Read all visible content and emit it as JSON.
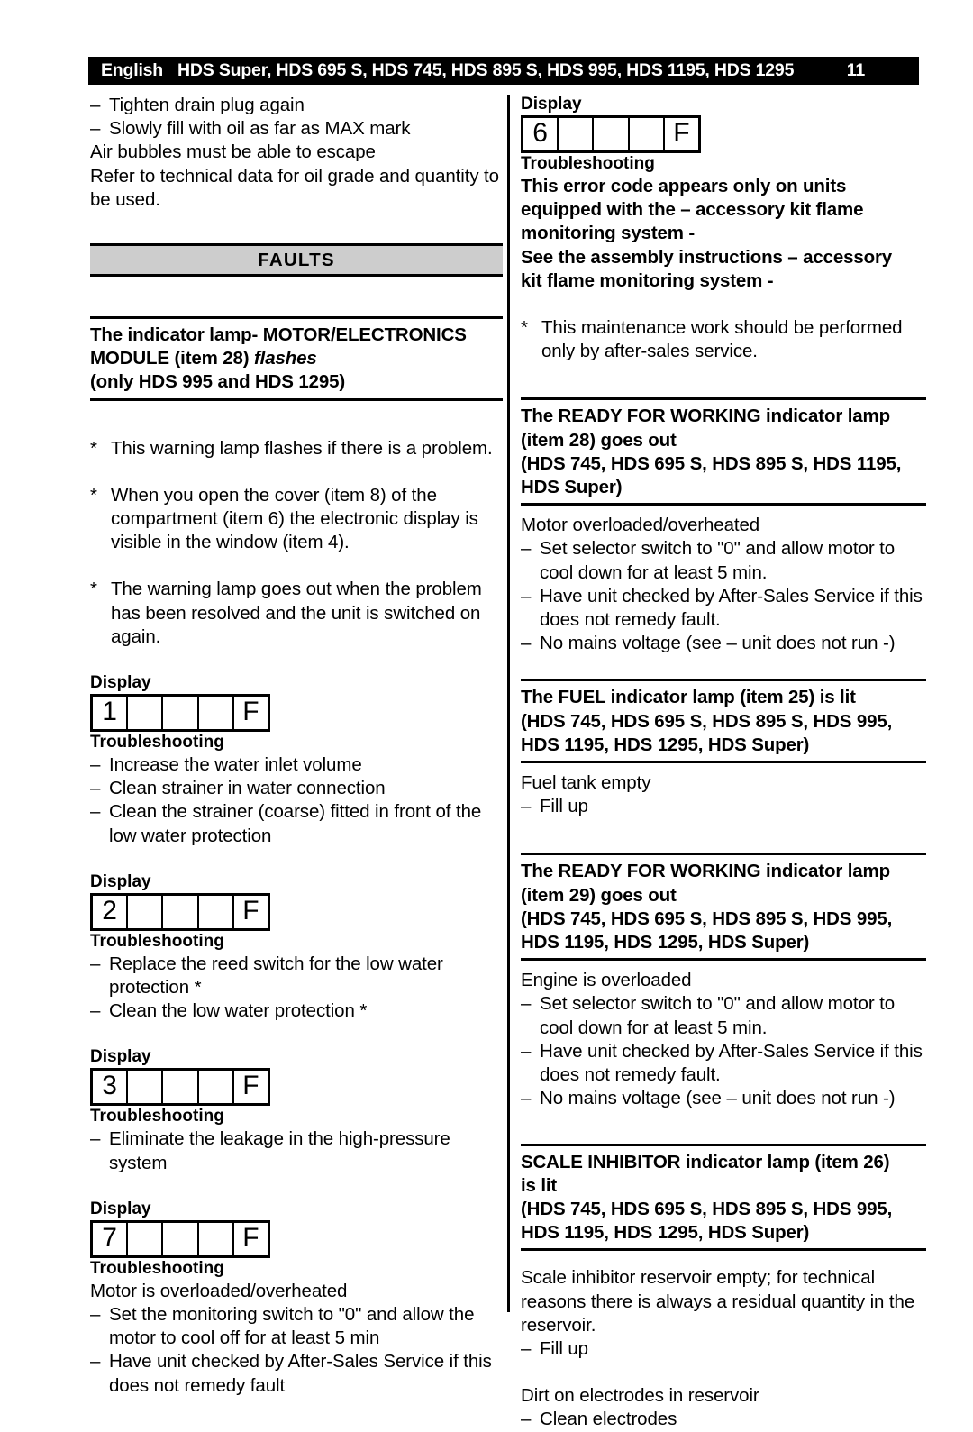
{
  "header": {
    "language": "English",
    "models": "HDS Super, HDS 695 S, HDS 745, HDS 895 S, HDS 995, HDS 1195, HDS 1295",
    "page_number": "11"
  },
  "left_column": {
    "intro_lines": [
      {
        "marker": "–",
        "text": "Tighten drain plug again"
      },
      {
        "marker": "–",
        "text": "Slowly fill with oil as far as MAX mark"
      },
      {
        "marker": "",
        "text": "Air bubbles must be able to escape"
      },
      {
        "marker": "",
        "text": "Refer to technical data for oil grade and quantity to be used."
      }
    ],
    "faults_band": "FAULTS",
    "fault_heading": {
      "line1": "The indicator lamp- MOTOR/ELECTRONICS",
      "line2_plain": "MODULE (item 28) ",
      "line2_italic": "flashes",
      "line3": "(only HDS 995 and HDS 1295)"
    },
    "notes": [
      {
        "marker": "*",
        "text": "This warning lamp flashes if there is a problem."
      },
      {
        "marker": "*",
        "text": "When you open the cover (item 8) of the compartment (item 6) the electronic display is visible in the window (item 4)."
      },
      {
        "marker": "*",
        "text": "The warning lamp goes out when the problem has been resolved and the unit is switched on again."
      }
    ],
    "display_label": "Display",
    "troubleshooting_label": "Troubleshooting",
    "fault_blocks": [
      {
        "code": "1",
        "suffix": "F",
        "cells": [
          "1",
          "",
          "",
          "",
          "F"
        ],
        "lines": [
          {
            "marker": "–",
            "text": "Increase the water inlet volume"
          },
          {
            "marker": "–",
            "text": "Clean strainer in water connection"
          },
          {
            "marker": "–",
            "text": "Clean the strainer (coarse) fitted in front of the low water protection"
          }
        ]
      },
      {
        "code": "2",
        "suffix": "F",
        "cells": [
          "2",
          "",
          "",
          "",
          "F"
        ],
        "lines": [
          {
            "marker": "–",
            "text": "Replace the reed switch for the low water protection *"
          },
          {
            "marker": "–",
            "text": "Clean the low water protection *"
          }
        ]
      },
      {
        "code": "3",
        "suffix": "F",
        "cells": [
          "3",
          "",
          "",
          "",
          "F"
        ],
        "lines": [
          {
            "marker": "–",
            "text": "Eliminate the leakage in the high-pressure system"
          }
        ]
      },
      {
        "code": "7",
        "suffix": "F",
        "cells": [
          "7",
          "",
          "",
          "",
          "F"
        ],
        "plain_line": "Motor is overloaded/overheated",
        "lines": [
          {
            "marker": "–",
            "text": "Set the monitoring switch to \"0\" and allow the motor to cool off for at least 5  min"
          },
          {
            "marker": "–",
            "text": "Have unit checked by After-Sales Service if this does not remedy fault"
          }
        ]
      }
    ]
  },
  "right_column": {
    "display_label": "Display",
    "troubleshooting_label": "Troubleshooting",
    "block_6": {
      "cells": [
        "6",
        "",
        "",
        "",
        "F"
      ],
      "bold_lines": [
        "This error code appears only on units",
        "equipped with the – accessory kit flame",
        "monitoring system -",
        "See the assembly instructions – accessory",
        "kit flame monitoring system -"
      ]
    },
    "footnote": {
      "marker": "*",
      "text": "This maintenance work should be performed only by after-sales service."
    },
    "sections": [
      {
        "heading_lines": [
          "The READY FOR WORKING indicator lamp",
          "(item 28) goes out",
          "(HDS 745, HDS 695 S, HDS 895 S, HDS 1195,",
          "HDS Super)"
        ],
        "plain_line": "Motor overloaded/overheated",
        "lines": [
          {
            "marker": "–",
            "text": "Set selector switch to \"0\" and allow motor to cool down for at least 5 min."
          },
          {
            "marker": "–",
            "text": "Have unit checked by After-Sales Service if this does not remedy fault."
          },
          {
            "marker": "–",
            "text": "No mains voltage (see – unit does not run -)"
          }
        ]
      },
      {
        "heading_lines": [
          "The FUEL indicator lamp (item 25) is lit",
          "(HDS 745, HDS 695 S, HDS 895 S, HDS 995,",
          "HDS 1195, HDS 1295, HDS Super)"
        ],
        "plain_line": "Fuel tank empty",
        "lines": [
          {
            "marker": "–",
            "text": "Fill up"
          }
        ]
      },
      {
        "heading_lines": [
          "The READY FOR WORKING indicator lamp",
          "(item 29) goes out",
          "(HDS 745, HDS 695 S, HDS 895 S, HDS 995,",
          "HDS 1195, HDS 1295, HDS Super)"
        ],
        "plain_line": "Engine is overloaded",
        "lines": [
          {
            "marker": "–",
            "text": "Set selector switch to \"0\" and allow motor to cool down for at least 5 min."
          },
          {
            "marker": "–",
            "text": "Have unit checked by After-Sales Service if this does not remedy fault."
          },
          {
            "marker": "–",
            "text": "No mains voltage (see – unit does not run -)"
          }
        ]
      },
      {
        "heading_lines": [
          "SCALE INHIBITOR indicator lamp (item 26)",
          "is lit",
          "(HDS 745, HDS 695 S, HDS 895 S, HDS 995,",
          "HDS 1195, HDS 1295, HDS Super)"
        ],
        "plain_line": "Scale inhibitor reservoir empty; for technical reasons there is always a residual quantity in the reservoir.",
        "lines": [
          {
            "marker": "–",
            "text": "Fill up"
          }
        ],
        "plain_line_2": "Dirt on electrodes in reservoir",
        "lines_2": [
          {
            "marker": "–",
            "text": "Clean electrodes"
          }
        ]
      }
    ]
  }
}
